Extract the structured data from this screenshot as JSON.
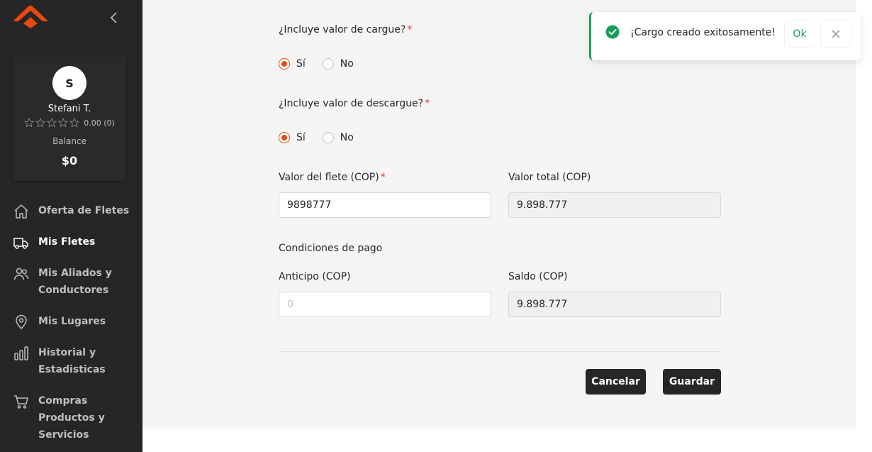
{
  "sidebar": {
    "profile": {
      "avatar_initial": "S",
      "name": "Stefani T.",
      "rating": "0.00 (0)",
      "balance_label": "Balance",
      "balance_value": "$0"
    },
    "nav": [
      {
        "label": "Oferta de Fletes",
        "icon": "home-icon"
      },
      {
        "label": "Mis Fletes",
        "icon": "truck-icon",
        "active": true
      },
      {
        "label": "Mis Aliados y Conductores",
        "icon": "users-icon"
      },
      {
        "label": "Mis Lugares",
        "icon": "map-pin-icon"
      },
      {
        "label": "Historial y Estadisticas",
        "icon": "bar-chart-icon"
      },
      {
        "label": "Compras Productos y Servicios",
        "icon": "cart-icon"
      }
    ]
  },
  "form": {
    "cargue": {
      "question": "¿Incluye valor de cargue?",
      "required_mark": "*",
      "options": [
        "Sí",
        "No"
      ],
      "selected": "Sí"
    },
    "descargue": {
      "question": "¿Incluye valor de descargue?",
      "required_mark": "*",
      "options": [
        "Sí",
        "No"
      ],
      "selected": "Sí"
    },
    "flete": {
      "label": "Valor del flete (COP)",
      "required_mark": "*",
      "value": "9898777"
    },
    "total": {
      "label": "Valor total (COP)",
      "value": "9.898.777"
    },
    "payment_title": "Condiciones de pago",
    "anticipo": {
      "label": "Anticipo (COP)",
      "placeholder": "0"
    },
    "saldo": {
      "label": "Saldo (COP)",
      "value": "9.898.777"
    },
    "buttons": {
      "cancel": "Cancelar",
      "save": "Guardar"
    }
  },
  "toast": {
    "message": "¡Cargo creado exitosamente!",
    "ok_label": "Ok"
  },
  "colors": {
    "brand": "#e8490f",
    "sidebar_bg": "#262626",
    "success": "#1b9e5a",
    "required": "#e53935"
  }
}
